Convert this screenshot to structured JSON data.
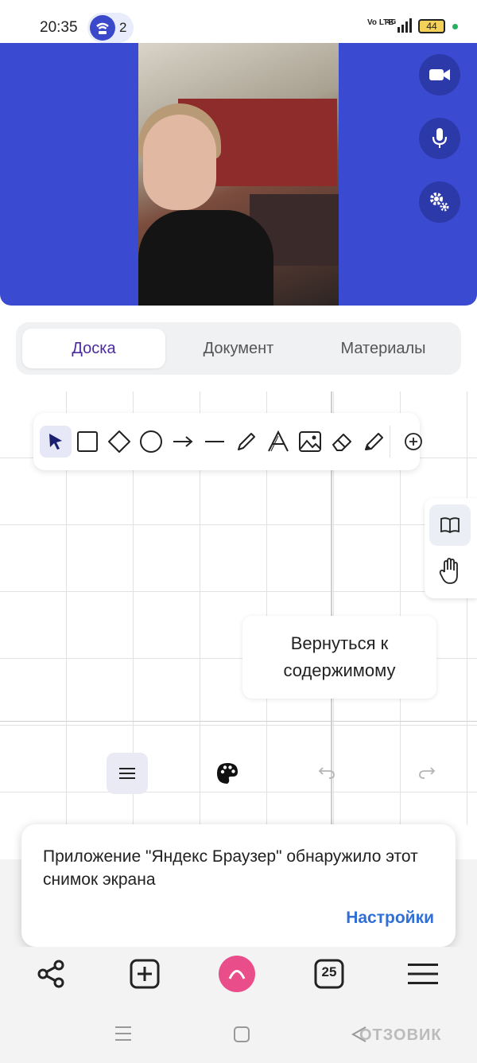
{
  "status_bar": {
    "time": "20:35",
    "hotspot_count": "2",
    "network": "4G",
    "volte": "Vo LTE",
    "battery": "44"
  },
  "tabs": [
    {
      "label": "Доска"
    },
    {
      "label": "Документ"
    },
    {
      "label": "Материалы"
    }
  ],
  "tools": [
    "select-icon",
    "rectangle-icon",
    "diamond-icon",
    "circle-icon",
    "arrow-icon",
    "line-icon",
    "pencil-icon",
    "text-icon",
    "image-icon",
    "eraser-icon",
    "marker-icon",
    "add-icon"
  ],
  "return_button": {
    "label": "Вернуться к содержимому"
  },
  "toast": {
    "message": "Приложение \"Яндекс Браузер\" обнаружило этот снимок экрана",
    "action": "Настройки"
  },
  "browser_bar": {
    "tabs_count": "25"
  },
  "watermark": "ОТЗОВИК",
  "colors": {
    "video_bg": "#3b4bd1",
    "accent": "#4a2c9e",
    "link": "#2f6fd6"
  }
}
